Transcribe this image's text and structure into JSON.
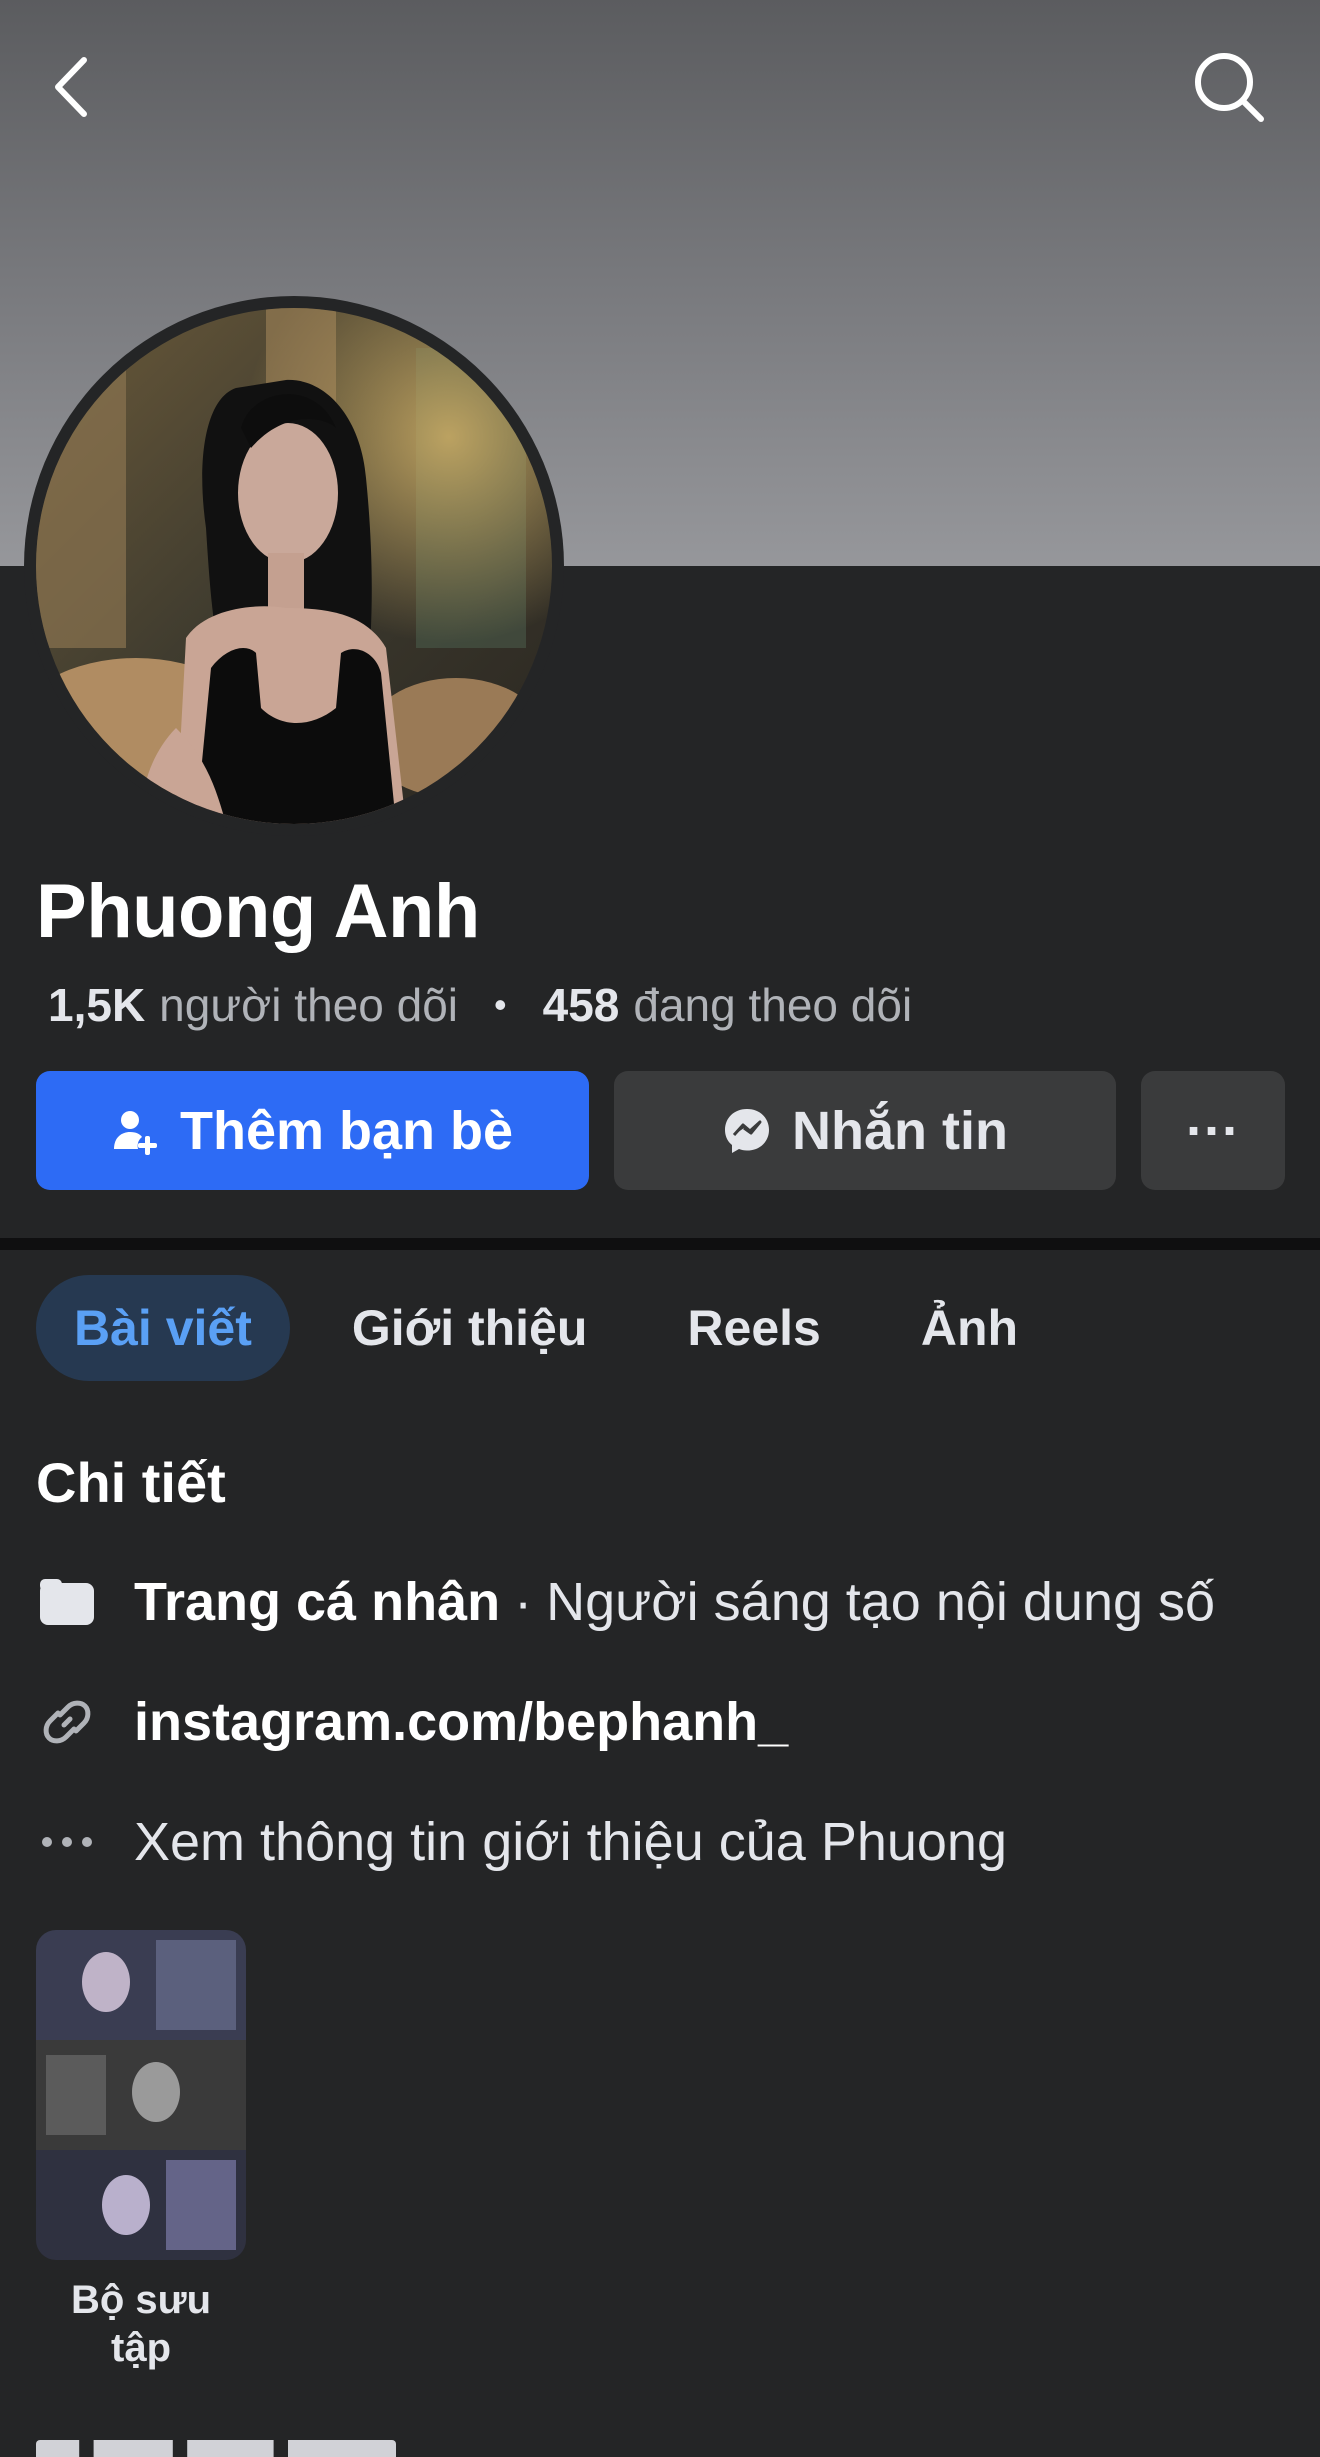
{
  "profile": {
    "name": "Phuong Anh",
    "followers_count": "1,5K",
    "followers_label": "người theo dõi",
    "following_count": "458",
    "following_label": "đang theo dõi"
  },
  "actions": {
    "add_friend_label": "Thêm bạn bè",
    "message_label": "Nhắn tin",
    "more_label": "···"
  },
  "tabs": [
    {
      "label": "Bài viết",
      "active": true
    },
    {
      "label": "Giới thiệu",
      "active": false
    },
    {
      "label": "Reels",
      "active": false
    },
    {
      "label": "Ảnh",
      "active": false
    }
  ],
  "details": {
    "title": "Chi tiết",
    "page_type_bold": "Trang cá nhân",
    "page_type_sep": "·",
    "page_type_category": "Người sáng tạo nội dung số",
    "link": "instagram.com/bephanh_",
    "about_link": "Xem thông tin giới thiệu của Phuong"
  },
  "collection": {
    "label": "Bộ sưu tập"
  },
  "colors": {
    "primary": "#2d6bf5",
    "background": "#242526",
    "secondary_button": "#3a3b3c",
    "active_tab_bg": "#263951",
    "active_tab_text": "#5aa0f5"
  },
  "icons": [
    "back-arrow-icon",
    "search-icon",
    "add-friend-icon",
    "messenger-icon",
    "more-icon",
    "page-icon",
    "link-icon",
    "ellipsis-icon"
  ]
}
